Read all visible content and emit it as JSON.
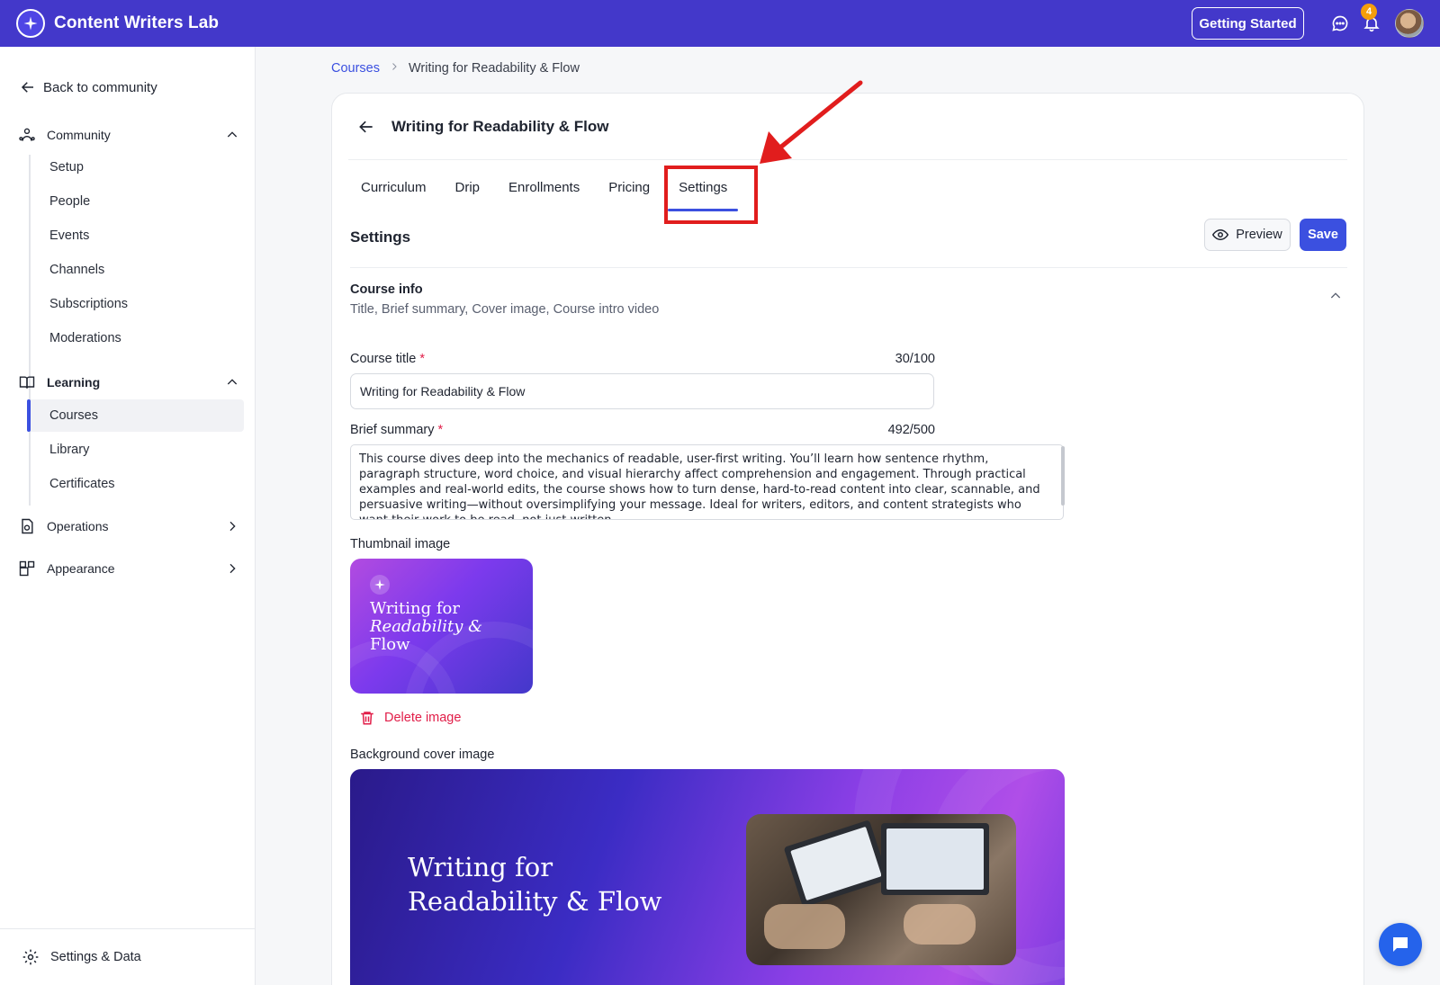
{
  "app": {
    "name": "Content Writers Lab"
  },
  "topbar": {
    "getting_started_label": "Getting Started",
    "notification_count": "4"
  },
  "sidebar": {
    "back_label": "Back to community",
    "community": {
      "label": "Community",
      "items": [
        "Setup",
        "People",
        "Events",
        "Channels",
        "Subscriptions",
        "Moderations"
      ]
    },
    "learning": {
      "label": "Learning",
      "items": [
        "Courses",
        "Library",
        "Certificates"
      ],
      "active": "Courses"
    },
    "operations_label": "Operations",
    "appearance_label": "Appearance",
    "settings_data_label": "Settings & Data"
  },
  "breadcrumb": {
    "parent": "Courses",
    "current": "Writing for Readability & Flow"
  },
  "course": {
    "title": "Writing for Readability & Flow",
    "tabs": [
      "Curriculum",
      "Drip",
      "Enrollments",
      "Pricing",
      "Settings"
    ],
    "active_tab": "Settings"
  },
  "settings": {
    "heading": "Settings",
    "preview_label": "Preview",
    "save_label": "Save",
    "course_info": {
      "title": "Course info",
      "subtitle": "Title, Brief summary, Cover image, Course intro video"
    },
    "course_title_field": {
      "label": "Course title",
      "required_mark": "*",
      "count": "30/100",
      "value": "Writing for Readability & Flow"
    },
    "summary_field": {
      "label": "Brief summary",
      "required_mark": "*",
      "count": "492/500",
      "value": "This course dives deep into the mechanics of readable, user-first writing. You’ll learn how sentence rhythm, paragraph structure, word choice, and visual hierarchy affect comprehension and engagement. Through practical examples and real-world edits, the course shows how to turn dense, hard-to-read content into clear, scannable, and persuasive writing—without oversimplifying your message. Ideal for writers, editors, and content strategists who want their work to be read, not just written."
    },
    "thumbnail": {
      "label": "Thumbnail image",
      "title_line1": "Writing for",
      "title_line2": "Readability &",
      "title_line3": "Flow",
      "delete_label": "Delete image"
    },
    "cover": {
      "label": "Background cover image",
      "title_line1": "Writing for",
      "title_line2": "Readability & Flow"
    }
  },
  "colors": {
    "brand": "#4338ca",
    "accent": "#3b50e0",
    "highlight": "#e11d1d",
    "danger": "#e11d48"
  }
}
